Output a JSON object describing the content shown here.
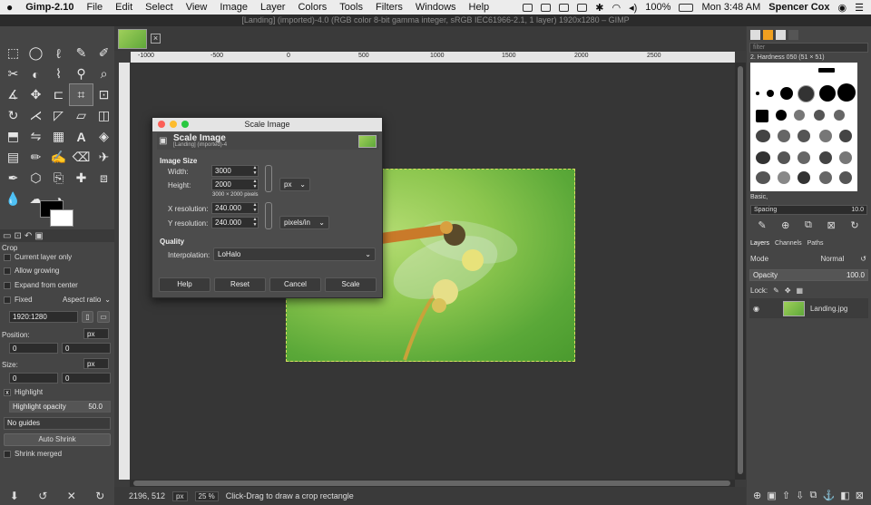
{
  "menubar": {
    "apple": "",
    "app_name": "Gimp-2.10",
    "items": [
      "File",
      "Edit",
      "Select",
      "View",
      "Image",
      "Layer",
      "Colors",
      "Tools",
      "Filters",
      "Windows",
      "Help"
    ],
    "battery": "100%",
    "clock": "Mon 3:48 AM",
    "user": "Spencer Cox"
  },
  "window_title": "[Landing] (imported)-4.0 (RGB color 8-bit gamma integer, sRGB IEC61966-2.1, 1 layer) 1920x1280 – GIMP",
  "tool_options": {
    "tool": "Crop",
    "current_layer_only": "Current layer only",
    "allow_growing": "Allow growing",
    "expand_from_center": "Expand from center",
    "fixed": "Fixed",
    "aspect": "Aspect ratio",
    "ratio_value": "1920:1280",
    "position_label": "Position:",
    "position_unit": "px",
    "position_x": "0",
    "position_y": "0",
    "size_label": "Size:",
    "size_unit": "px",
    "size_x": "0",
    "size_y": "0",
    "highlight": "Highlight",
    "highlight_opacity_label": "Highlight opacity",
    "highlight_opacity_value": "50.0",
    "guides": "No guides",
    "auto_shrink": "Auto Shrink",
    "shrink_merged": "Shrink merged"
  },
  "ruler": {
    "ticks": [
      "-1000",
      "-500",
      "0",
      "500",
      "1000",
      "1500",
      "2000",
      "2500"
    ]
  },
  "status": {
    "coords": "2196, 512",
    "unit": "px",
    "zoom": "25 %",
    "message": "Click-Drag to draw a crop rectangle"
  },
  "dock": {
    "filter_placeholder": "filter",
    "brush_name": "2. Hardness 050 (51 × 51)",
    "brush_tag": "Basic,",
    "spacing_label": "Spacing",
    "spacing_value": "10.0",
    "tabs": [
      "Layers",
      "Channels",
      "Paths"
    ],
    "mode_label": "Mode",
    "mode_value": "Normal",
    "opacity_label": "Opacity",
    "opacity_value": "100.0",
    "lock_label": "Lock:",
    "layer_name": "Landing.jpg"
  },
  "dialog": {
    "title": "Scale Image",
    "header_title": "Scale Image",
    "header_sub": "[Landing] (imported)-4",
    "image_size_label": "Image Size",
    "width_label": "Width:",
    "width_value": "3000",
    "height_label": "Height:",
    "height_value": "2000",
    "pixels_note": "3000 × 2000 pixels",
    "size_unit": "px",
    "xres_label": "X resolution:",
    "xres_value": "240.000",
    "yres_label": "Y resolution:",
    "yres_value": "240.000",
    "res_unit": "pixels/in",
    "quality_label": "Quality",
    "interp_label": "Interpolation:",
    "interp_value": "LoHalo",
    "btn_help": "Help",
    "btn_reset": "Reset",
    "btn_cancel": "Cancel",
    "btn_scale": "Scale"
  }
}
